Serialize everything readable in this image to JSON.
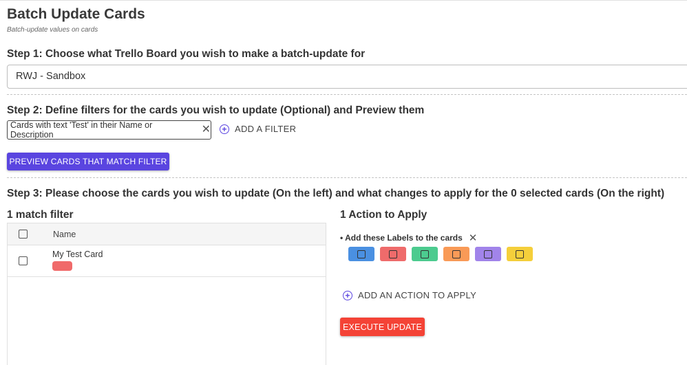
{
  "page": {
    "title": "Batch Update Cards",
    "subtitle": "Batch-update values on cards"
  },
  "step1": {
    "heading": "Step 1: Choose what Trello Board you wish to make a batch-update for",
    "selected_board": "RWJ - Sandbox"
  },
  "step2": {
    "heading": "Step 2: Define filters for the cards you wish to update (Optional) and Preview them",
    "filter_chip": "Cards with text 'Test' in their Name or Description",
    "add_filter_label": "ADD A FILTER",
    "preview_button": "PREVIEW CARDS THAT MATCH FILTER"
  },
  "step3": {
    "heading": "Step 3: Please choose the cards you wish to update (On the left) and what changes to apply for the 0 selected cards (On the right)",
    "match_heading": "1 match filter",
    "table": {
      "column_name": "Name",
      "rows": [
        {
          "name": "My Test Card",
          "label_color": "#f06a6a"
        }
      ]
    },
    "actions_heading": "1 Action to Apply",
    "action_item": "• Add these Labels to the cards",
    "label_colors": [
      "#4a90e2",
      "#ef6b6b",
      "#4ccb8f",
      "#f99a57",
      "#a184ea",
      "#f5cf3b"
    ],
    "add_action_label": "ADD AN ACTION TO APPLY",
    "execute_button": "EXECUTE UPDATE"
  },
  "colors": {
    "primary": "#5a45e0",
    "danger": "#f44336"
  }
}
